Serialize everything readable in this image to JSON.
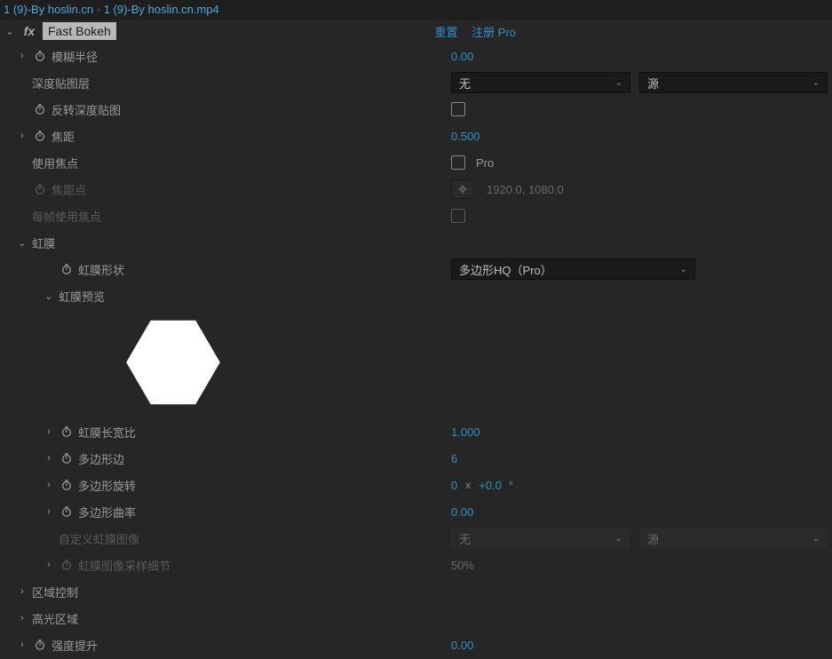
{
  "title": "1 (9)-By hoslin.cn · 1 (9)-By hoslin.cn.mp4",
  "effect": {
    "name": "Fast Bokeh",
    "reset": "重置",
    "register": "注册 Pro"
  },
  "params": {
    "blur_radius": {
      "label": "模糊半径",
      "value": "0.00"
    },
    "depth_layer": {
      "label": "深度贴图层",
      "dropdown1": "无",
      "dropdown2": "源"
    },
    "invert_depth": {
      "label": "反转深度贴图"
    },
    "focal_distance": {
      "label": "焦距",
      "value": "0.500"
    },
    "use_focus": {
      "label": "使用焦点",
      "suffix": "Pro"
    },
    "focus_point": {
      "label": "焦距点",
      "coords": "1920.0, 1080.0"
    },
    "per_frame_focus": {
      "label": "每帧使用焦点"
    },
    "iris": {
      "label": "虹膜",
      "shape": {
        "label": "虹膜形状",
        "value": "多边形HQ（Pro）"
      },
      "preview_label": "虹膜预览",
      "aspect": {
        "label": "虹膜长宽比",
        "value": "1.000"
      },
      "sides": {
        "label": "多边形边",
        "value": "6"
      },
      "rotation": {
        "label": "多边形旋转",
        "rev": "0",
        "deg": "+0.0"
      },
      "curvature": {
        "label": "多边形曲率",
        "value": "0.00"
      },
      "custom_image": {
        "label": "自定义虹膜图像",
        "dropdown1": "无",
        "dropdown2": "源"
      },
      "sample_detail": {
        "label": "虹膜图像采样细节",
        "value": "50%"
      }
    },
    "region_control": {
      "label": "区域控制"
    },
    "highlight_region": {
      "label": "高光区域"
    },
    "intensity_boost": {
      "label": "强度提升",
      "value": "0.00"
    }
  }
}
